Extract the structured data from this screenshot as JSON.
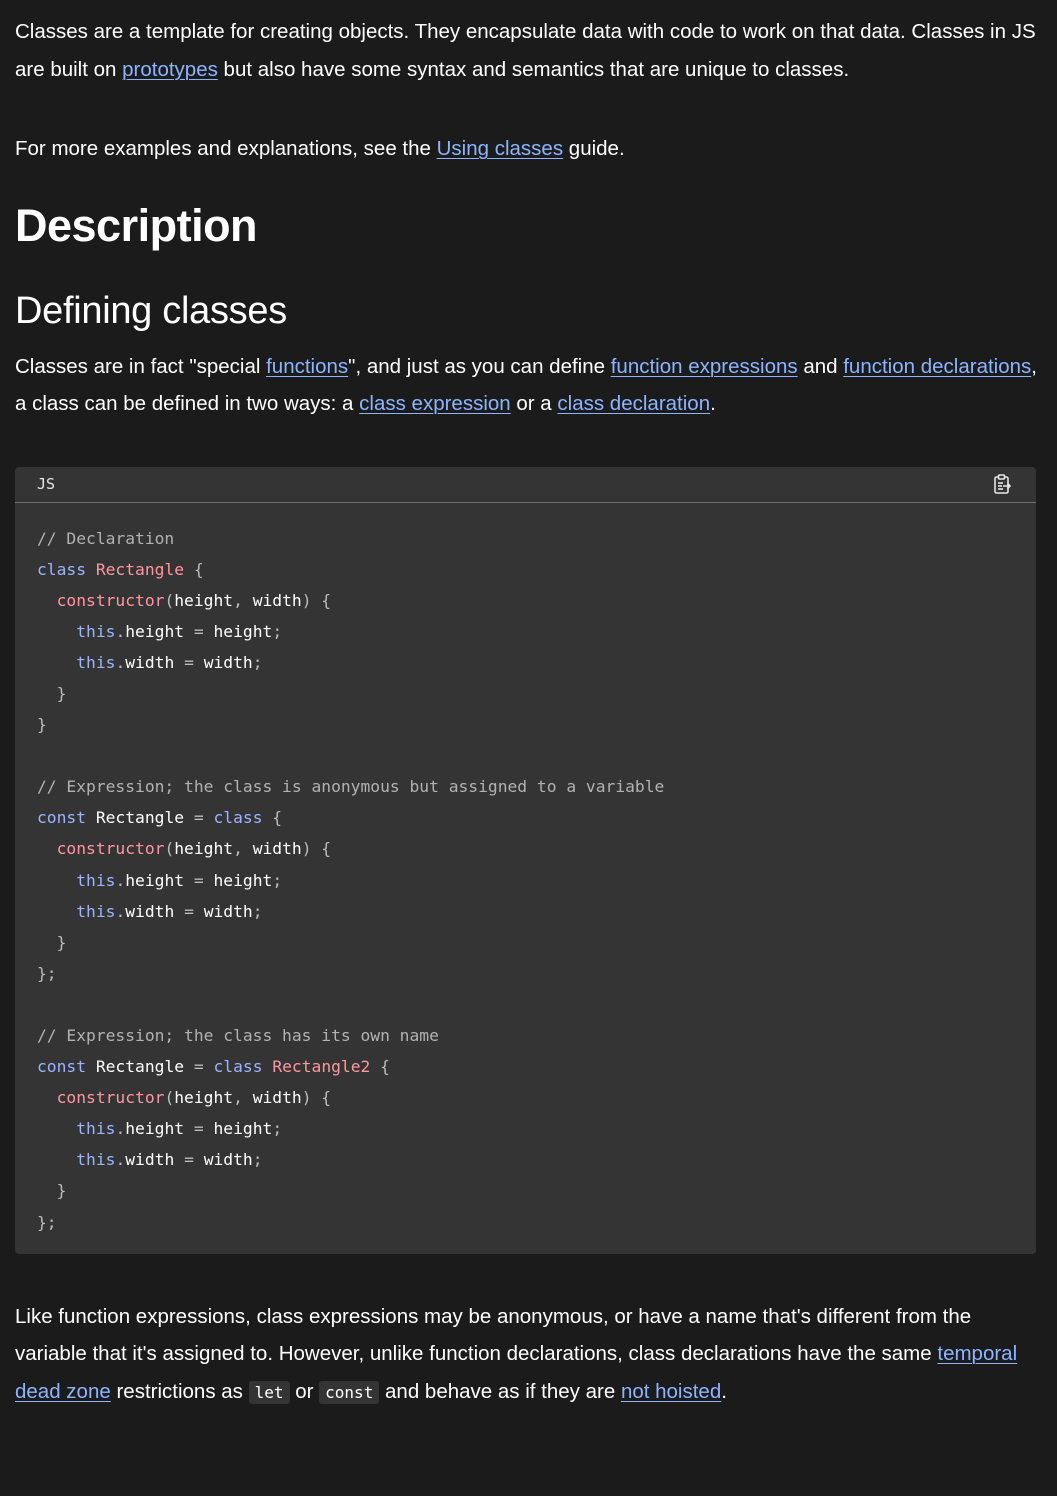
{
  "intro": {
    "text_before_link": "Classes are a template for creating objects. They encapsulate data with code to work on that data. Classes in JS are built on ",
    "link_prototypes": "prototypes",
    "text_after_link": " but also have some syntax and semantics that are unique to classes."
  },
  "more_examples": {
    "text_before_link": "For more examples and explanations, see the ",
    "link_using_classes": "Using classes",
    "text_after_link": " guide."
  },
  "section_heading": "Description",
  "subsection_heading": "Defining classes",
  "defining": {
    "t1": "Classes are in fact \"special ",
    "link_functions": "functions",
    "t2": "\", and just as you can define ",
    "link_function_expressions": "function expressions",
    "t3": " and ",
    "link_function_declarations": "function declarations",
    "t4": ", a class can be defined in two ways: a ",
    "link_class_expression": "class expression",
    "t5": " or a ",
    "link_class_declaration": "class declaration",
    "t6": "."
  },
  "code_block": {
    "language": "JS",
    "copy_icon": "clipboard-icon",
    "lines": [
      [
        {
          "t": "// Declaration",
          "k": "comment"
        }
      ],
      [
        {
          "t": "class",
          "k": "keyword"
        },
        {
          "t": " ",
          "k": "plain"
        },
        {
          "t": "Rectangle",
          "k": "name"
        },
        {
          "t": " {",
          "k": "punct"
        }
      ],
      [
        {
          "t": "  ",
          "k": "plain"
        },
        {
          "t": "constructor",
          "k": "name"
        },
        {
          "t": "(",
          "k": "punct"
        },
        {
          "t": "height",
          "k": "prop"
        },
        {
          "t": ", ",
          "k": "punct"
        },
        {
          "t": "width",
          "k": "prop"
        },
        {
          "t": ") {",
          "k": "punct"
        }
      ],
      [
        {
          "t": "    ",
          "k": "plain"
        },
        {
          "t": "this",
          "k": "keyword"
        },
        {
          "t": ".",
          "k": "punct"
        },
        {
          "t": "height",
          "k": "prop"
        },
        {
          "t": " = ",
          "k": "punct"
        },
        {
          "t": "height",
          "k": "prop"
        },
        {
          "t": ";",
          "k": "punct"
        }
      ],
      [
        {
          "t": "    ",
          "k": "plain"
        },
        {
          "t": "this",
          "k": "keyword"
        },
        {
          "t": ".",
          "k": "punct"
        },
        {
          "t": "width",
          "k": "prop"
        },
        {
          "t": " = ",
          "k": "punct"
        },
        {
          "t": "width",
          "k": "prop"
        },
        {
          "t": ";",
          "k": "punct"
        }
      ],
      [
        {
          "t": "  }",
          "k": "punct"
        }
      ],
      [
        {
          "t": "}",
          "k": "punct"
        }
      ],
      [],
      [
        {
          "t": "// Expression; the class is anonymous but assigned to a variable",
          "k": "comment"
        }
      ],
      [
        {
          "t": "const",
          "k": "keyword"
        },
        {
          "t": " ",
          "k": "plain"
        },
        {
          "t": "Rectangle",
          "k": "prop"
        },
        {
          "t": " = ",
          "k": "punct"
        },
        {
          "t": "class",
          "k": "keyword"
        },
        {
          "t": " {",
          "k": "punct"
        }
      ],
      [
        {
          "t": "  ",
          "k": "plain"
        },
        {
          "t": "constructor",
          "k": "name"
        },
        {
          "t": "(",
          "k": "punct"
        },
        {
          "t": "height",
          "k": "prop"
        },
        {
          "t": ", ",
          "k": "punct"
        },
        {
          "t": "width",
          "k": "prop"
        },
        {
          "t": ") {",
          "k": "punct"
        }
      ],
      [
        {
          "t": "    ",
          "k": "plain"
        },
        {
          "t": "this",
          "k": "keyword"
        },
        {
          "t": ".",
          "k": "punct"
        },
        {
          "t": "height",
          "k": "prop"
        },
        {
          "t": " = ",
          "k": "punct"
        },
        {
          "t": "height",
          "k": "prop"
        },
        {
          "t": ";",
          "k": "punct"
        }
      ],
      [
        {
          "t": "    ",
          "k": "plain"
        },
        {
          "t": "this",
          "k": "keyword"
        },
        {
          "t": ".",
          "k": "punct"
        },
        {
          "t": "width",
          "k": "prop"
        },
        {
          "t": " = ",
          "k": "punct"
        },
        {
          "t": "width",
          "k": "prop"
        },
        {
          "t": ";",
          "k": "punct"
        }
      ],
      [
        {
          "t": "  }",
          "k": "punct"
        }
      ],
      [
        {
          "t": "};",
          "k": "punct"
        }
      ],
      [],
      [
        {
          "t": "// Expression; the class has its own name",
          "k": "comment"
        }
      ],
      [
        {
          "t": "const",
          "k": "keyword"
        },
        {
          "t": " ",
          "k": "plain"
        },
        {
          "t": "Rectangle",
          "k": "prop"
        },
        {
          "t": " = ",
          "k": "punct"
        },
        {
          "t": "class",
          "k": "keyword"
        },
        {
          "t": " ",
          "k": "plain"
        },
        {
          "t": "Rectangle2",
          "k": "name"
        },
        {
          "t": " {",
          "k": "punct"
        }
      ],
      [
        {
          "t": "  ",
          "k": "plain"
        },
        {
          "t": "constructor",
          "k": "name"
        },
        {
          "t": "(",
          "k": "punct"
        },
        {
          "t": "height",
          "k": "prop"
        },
        {
          "t": ", ",
          "k": "punct"
        },
        {
          "t": "width",
          "k": "prop"
        },
        {
          "t": ") {",
          "k": "punct"
        }
      ],
      [
        {
          "t": "    ",
          "k": "plain"
        },
        {
          "t": "this",
          "k": "keyword"
        },
        {
          "t": ".",
          "k": "punct"
        },
        {
          "t": "height",
          "k": "prop"
        },
        {
          "t": " = ",
          "k": "punct"
        },
        {
          "t": "height",
          "k": "prop"
        },
        {
          "t": ";",
          "k": "punct"
        }
      ],
      [
        {
          "t": "    ",
          "k": "plain"
        },
        {
          "t": "this",
          "k": "keyword"
        },
        {
          "t": ".",
          "k": "punct"
        },
        {
          "t": "width",
          "k": "prop"
        },
        {
          "t": " = ",
          "k": "punct"
        },
        {
          "t": "width",
          "k": "prop"
        },
        {
          "t": ";",
          "k": "punct"
        }
      ],
      [
        {
          "t": "  }",
          "k": "punct"
        }
      ],
      [
        {
          "t": "};",
          "k": "punct"
        }
      ]
    ]
  },
  "hoisting": {
    "t1": "Like function expressions, class expressions may be anonymous, or have a name that's different from the variable that it's assigned to. However, unlike function declarations, class declarations have the same ",
    "link_tdz": "temporal dead zone",
    "t2": " restrictions as ",
    "code_let": "let",
    "t3": " or ",
    "code_const": "const",
    "t4": " and behave as if they are ",
    "link_not_hoisted": "not hoisted",
    "t5": "."
  },
  "colors": {
    "background": "#1b1b1b",
    "code_background": "#343434",
    "link": "#8cb4ff",
    "keyword": "#9cb4ff",
    "name": "#ff97a0",
    "comment": "#b2b2b2"
  }
}
